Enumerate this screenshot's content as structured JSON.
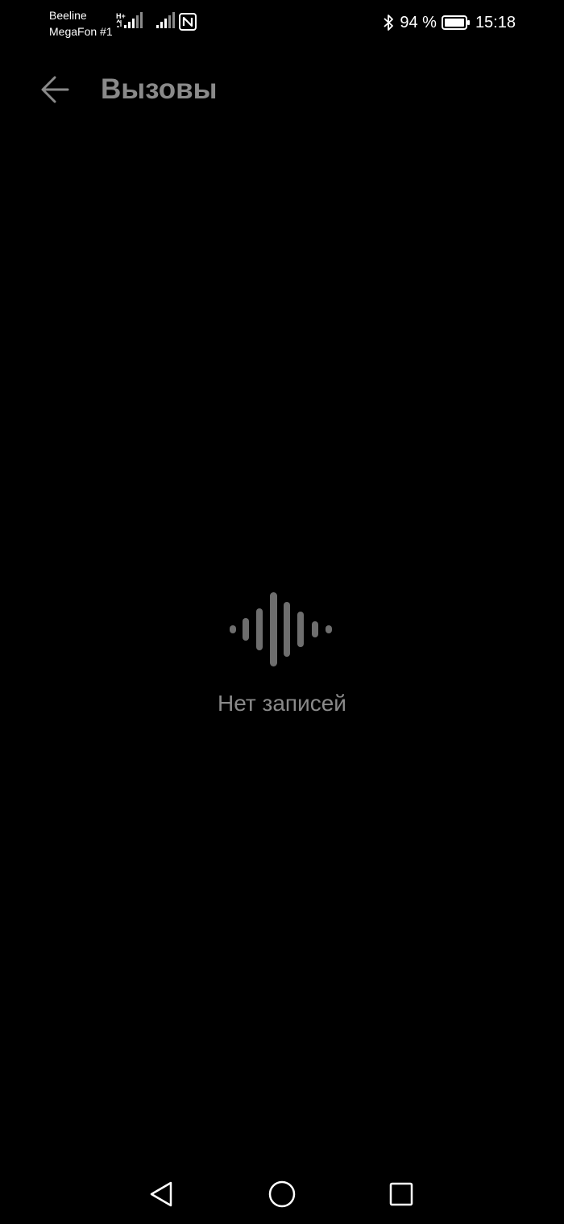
{
  "status_bar": {
    "carrier_1": "Beeline",
    "carrier_2": "MegaFon #1",
    "network_type": "H+",
    "battery_percent": "94 %",
    "time": "15:18",
    "icons": [
      "signal-icon",
      "signal-icon",
      "nfc-icon",
      "bluetooth-icon",
      "battery-icon"
    ]
  },
  "header": {
    "title": "Вызовы",
    "back_icon": "arrow-left-icon"
  },
  "empty_state": {
    "icon": "sound-wave-icon",
    "message": "Нет записей"
  },
  "nav_bar": {
    "buttons": [
      "nav-back-icon",
      "nav-home-icon",
      "nav-recents-icon"
    ]
  },
  "colors": {
    "background": "#000000",
    "title_text": "#8a8a8a",
    "muted_text": "#8a8a8a",
    "icon": "#6e6e6e",
    "status_text": "#ffffff"
  }
}
